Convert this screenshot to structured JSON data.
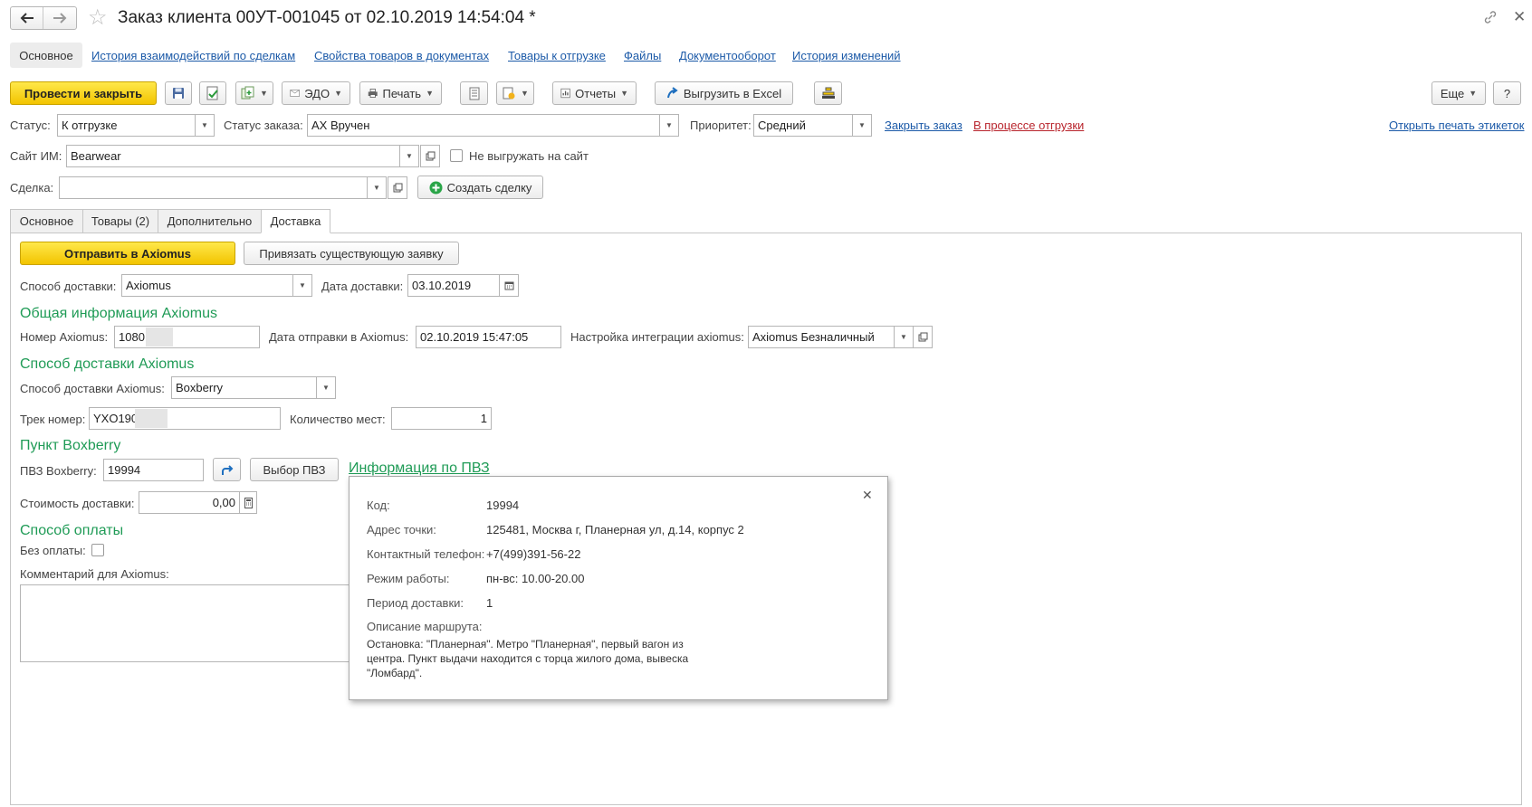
{
  "window": {
    "title": "Заказ клиента 00УТ-001045 от 02.10.2019 14:54:04 *"
  },
  "nav_links": [
    {
      "label": "Основное"
    },
    {
      "label": "История взаимодействий по сделкам"
    },
    {
      "label": "Свойства товаров в документах"
    },
    {
      "label": "Товары к отгрузке"
    },
    {
      "label": "Файлы"
    },
    {
      "label": "Документооборот"
    },
    {
      "label": "История изменений"
    }
  ],
  "toolbar": {
    "post_close": "Провести и закрыть",
    "edo": "ЭДО",
    "print": "Печать",
    "reports": "Отчеты",
    "export_excel": "Выгрузить в Excel",
    "more": "Еще",
    "help": "?"
  },
  "header_fields": {
    "status_label": "Статус:",
    "status_value": "К отгрузке",
    "order_status_label": "Статус заказа:",
    "order_status_value": "АХ Вручен",
    "priority_label": "Приоритет:",
    "priority_value": "Средний",
    "close_order_link": "Закрыть заказ",
    "shipping_process_link": "В процессе отгрузки",
    "print_labels_link": "Открыть печать этикеток",
    "site_label": "Сайт ИМ:",
    "site_value": "Bearwear",
    "no_upload_label": "Не выгружать на сайт",
    "deal_label": "Сделка:",
    "deal_value": "",
    "create_deal": "Создать сделку"
  },
  "tabs": [
    {
      "label": "Основное"
    },
    {
      "label": "Товары (2)"
    },
    {
      "label": "Дополнительно"
    },
    {
      "label": "Доставка"
    }
  ],
  "delivery": {
    "send_axiomus": "Отправить в Axiomus",
    "bind_request": "Привязать существующую заявку",
    "method_label": "Способ доставки:",
    "method_value": "Axiomus",
    "date_label": "Дата доставки:",
    "date_value": "03.10.2019",
    "general_section": "Общая информация Axiomus",
    "axiomus_number_label": "Номер Axiomus:",
    "axiomus_number_value": "1080",
    "send_date_label": "Дата отправки в Axiomus:",
    "send_date_value": "02.10.2019 15:47:05",
    "integration_label": "Настройка интеграции axiomus:",
    "integration_value": "Axiomus Безналичный",
    "axiomus_method_section": "Способ доставки Axiomus",
    "axiomus_method_label": "Способ доставки Axiomus:",
    "axiomus_method_value": "Boxberry",
    "track_label": "Трек номер:",
    "track_value": "YXO190",
    "places_label": "Количество мест:",
    "places_value": "1",
    "point_section": "Пункт Boxberry",
    "pvz_label": "ПВЗ Boxberry:",
    "pvz_value": "19994",
    "choose_pvz": "Выбор ПВЗ",
    "pvz_info_link": "Информация по ПВЗ",
    "cost_label": "Стоимость доставки:",
    "cost_value": "0,00",
    "payment_section": "Способ оплаты",
    "no_payment_label": "Без оплаты:",
    "comment_label": "Комментарий для Axiomus:"
  },
  "popup": {
    "code_label": "Код:",
    "code_value": "19994",
    "address_label": "Адрес точки:",
    "address_value": "125481, Москва г, Планерная ул, д.14, корпус 2",
    "phone_label": "Контактный телефон:",
    "phone_value": "+7(499)391-56-22",
    "hours_label": "Режим работы:",
    "hours_value": "пн-вс: 10.00-20.00",
    "period_label": "Период доставки:",
    "period_value": "1",
    "route_label": "Описание маршрута:",
    "route_line1": "Остановка: \"Планерная\". Метро \"Планерная\", первый вагон из",
    "route_line2": "центра.  Пункт выдачи находится с торца жилого дома, вывеска",
    "route_line3": "\"Ломбард\"."
  }
}
